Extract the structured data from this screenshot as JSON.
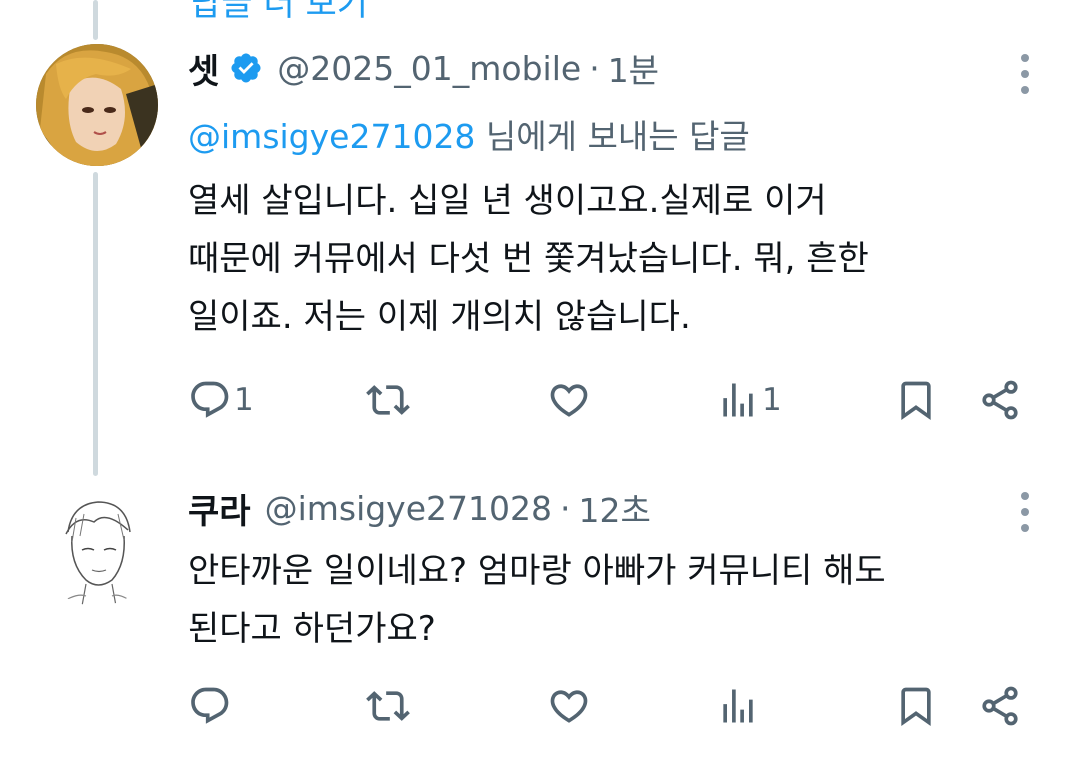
{
  "top_cut_text": "답글 더 보기",
  "tweets": [
    {
      "name": "셋",
      "verified": true,
      "handle": "@2025_01_mobile",
      "separator": "·",
      "time": "1분",
      "reply_to_mention": "@imsigye271028",
      "reply_to_suffix": " 님에게 보내는 답글",
      "lines": [
        "열세 살입니다. 십일 년 생이고요.실제로 이거",
        "때문에 커뮤에서 다섯 번 쫓겨났습니다. 뭐, 흔한",
        "일이죠. 저는 이제 개의치 않습니다."
      ],
      "reply_count": "1",
      "views_count": "1"
    },
    {
      "name": "쿠라",
      "handle": "@imsigye271028",
      "separator": "·",
      "time": "12초",
      "lines": [
        "안타까운 일이네요? 엄마랑 아빠가 커뮤니티 해도",
        "된다고 하던가요?"
      ]
    }
  ],
  "icons": {
    "reply": "reply-icon",
    "retweet": "retweet-icon",
    "like": "heart-icon",
    "views": "views-icon",
    "bookmark": "bookmark-icon",
    "share": "share-icon",
    "more": "more-vertical-icon",
    "verified": "verified-badge-icon"
  },
  "colors": {
    "accent": "#1d9bf0",
    "secondary_text": "#536471",
    "thread_line": "#cfd9de"
  }
}
